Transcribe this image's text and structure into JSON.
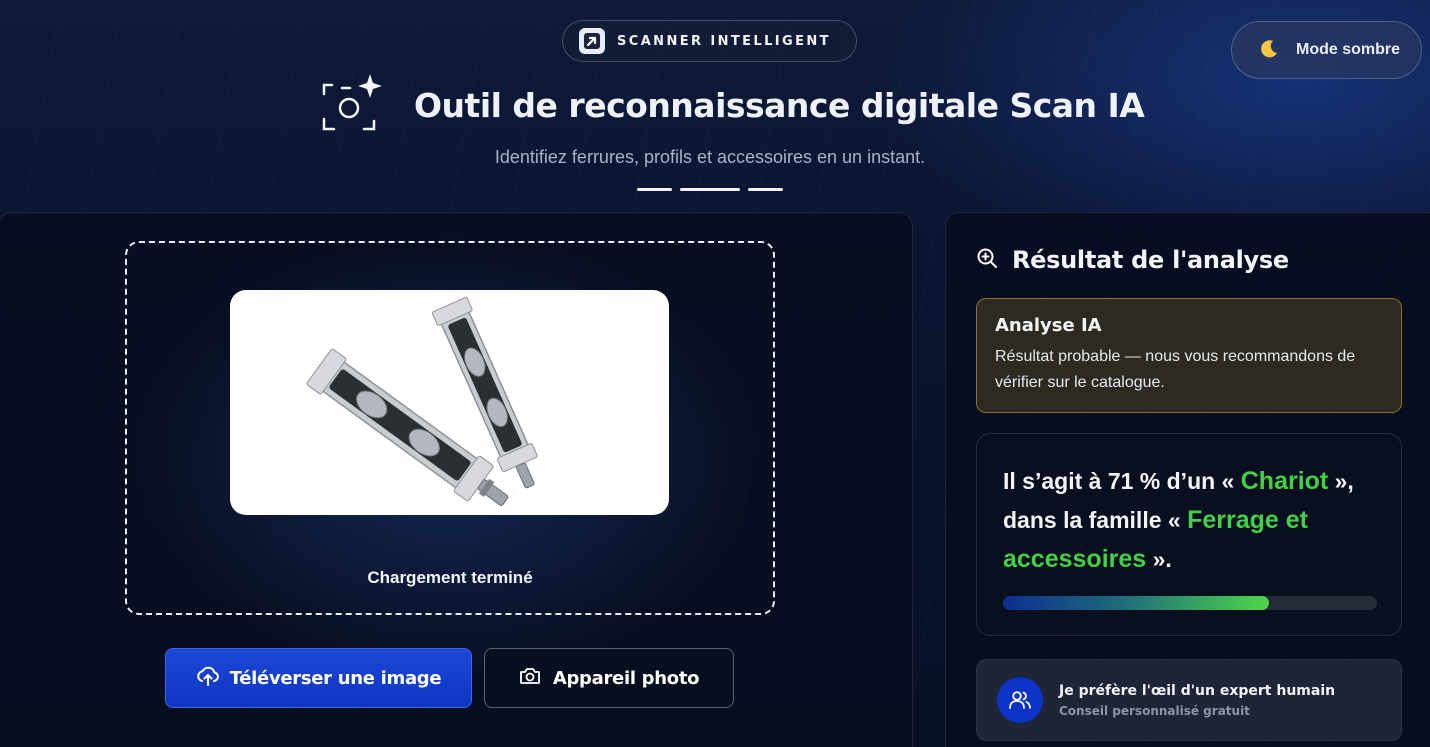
{
  "header": {
    "badge_label": "SCANNER INTELLIGENT",
    "badge_icon": "arrow-square-icon",
    "title": "Outil de reconnaissance digitale Scan IA",
    "title_icon": "camera-scan-sparkle-icon",
    "subtitle": "Identifiez ferrures, profils et accessoires en un instant.",
    "theme_toggle": {
      "label": "Mode sombre",
      "icon": "moon-icon"
    }
  },
  "upload": {
    "status": "Chargement terminé",
    "upload_button": {
      "label": "Téléverser une image",
      "icon": "cloud-upload-icon"
    },
    "camera_button": {
      "label": "Appareil photo",
      "icon": "camera-icon"
    }
  },
  "result": {
    "title": "Résultat de l'analyse",
    "title_icon": "zoom-in-icon",
    "warning": {
      "title": "Analyse IA",
      "text": "Résultat probable — nous vous recommandons de vérifier sur le catalogue."
    },
    "sentence": {
      "prefix": "Il s’agit à 71 % d’un « ",
      "item": "Chariot",
      "middle": " », dans la famille « ",
      "family": "Ferrage et accessoires",
      "suffix": " »."
    },
    "confidence": 0.71,
    "expert": {
      "title": "Je préfère l'œil d'un expert humain",
      "subtitle": "Conseil personnalisé gratuit",
      "icon": "users-icon"
    }
  },
  "colors": {
    "accent_blue": "#1c47d8",
    "highlight_green": "#43d046",
    "warning_border": "#8a7330",
    "background": "#0b1228"
  }
}
